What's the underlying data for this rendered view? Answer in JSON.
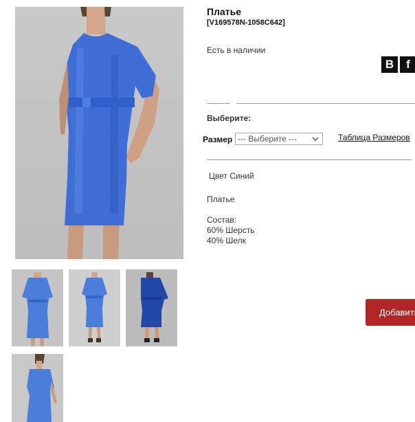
{
  "product": {
    "title": "Платье",
    "sku": "[V169578N-1058C642]",
    "stock_status": "Есть в наличии",
    "choose_label": "Выберите:",
    "size_label": "Размер",
    "size_select_value": "--- Выберите ---",
    "size_table_link": "Таблица Размеров",
    "color_line": "Цвет Синий",
    "description": "Платье",
    "composition_label": "Состав:",
    "composition": [
      "60% Шерсть",
      "40% Шелк"
    ],
    "add_button_label": "Добавить"
  },
  "social": {
    "vk_label": "B",
    "fb_label": "f"
  },
  "colors": {
    "dress_blue": "#3f6fd6",
    "button_red": "#b32626",
    "photo_bg": "#c3c3c3"
  }
}
